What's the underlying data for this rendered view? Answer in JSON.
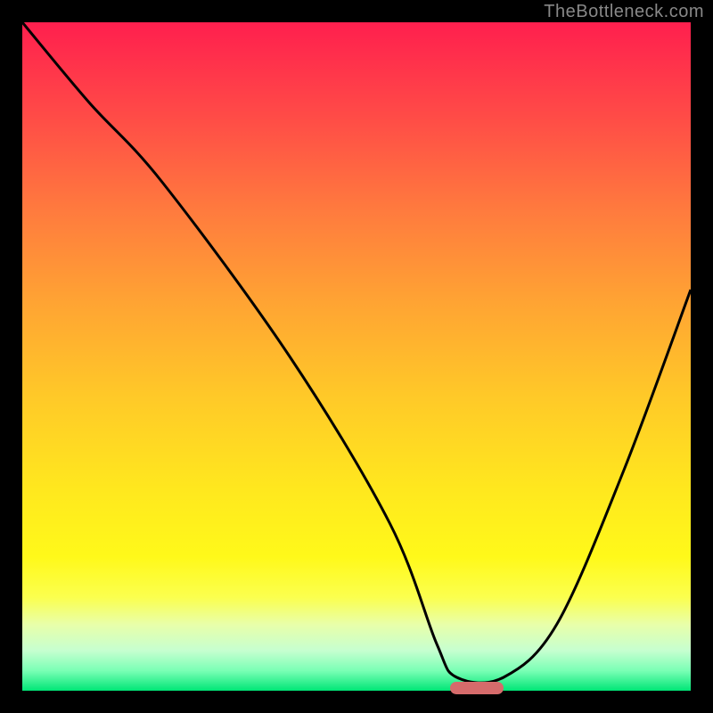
{
  "attribution": "TheBottleneck.com",
  "colors": {
    "gradient_top": "#ff1f4e",
    "gradient_bottom": "#00e676",
    "curve": "#000000",
    "marker": "#d66b6b",
    "frame": "#000000"
  },
  "chart_data": {
    "type": "line",
    "title": "",
    "xlabel": "",
    "ylabel": "",
    "xlim": [
      0,
      100
    ],
    "ylim": [
      0,
      100
    ],
    "grid": false,
    "legend": false,
    "series": [
      {
        "name": "bottleneck-curve",
        "x": [
          0,
          10,
          21,
          40,
          55,
          62,
          65,
          72,
          80,
          90,
          100
        ],
        "values": [
          100,
          88,
          76,
          50,
          25,
          7,
          2,
          2,
          10,
          33,
          60
        ]
      }
    ],
    "marker": {
      "x_start": 64,
      "x_end": 72,
      "y": 0
    }
  }
}
